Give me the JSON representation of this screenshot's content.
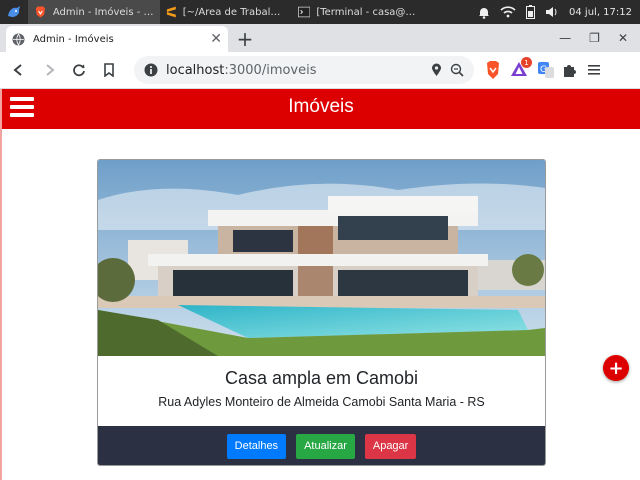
{
  "taskbar": {
    "tasks": [
      {
        "label": "Admin - Imóveis - Br..."
      },
      {
        "label": "[~/Área de Trabalho/i..."
      },
      {
        "label": "[Terminal - casa@cas..."
      }
    ],
    "clock": "04 jul, 17:12"
  },
  "browser": {
    "tab_title": "Admin - Imóveis",
    "url_host": "localhost",
    "url_path": ":3000/imoveis",
    "extension_badge": "1"
  },
  "app": {
    "title": "Imóveis",
    "accent": "#dd0000"
  },
  "card": {
    "title": "Casa ampla em Camobi",
    "address": "Rua Adyles Monteiro de Almeida Camobi Santa Maria - RS",
    "buttons": {
      "details": "Detalhes",
      "update": "Atualizar",
      "delete": "Apagar"
    }
  },
  "fab": {
    "label": "+"
  },
  "icons": [
    "brave-icon",
    "sublime-icon",
    "terminal-icon",
    "bell-icon",
    "wifi-icon",
    "battery-icon",
    "volume-icon",
    "globe-icon",
    "back-icon",
    "forward-icon",
    "reload-icon",
    "bookmark-icon",
    "info-icon",
    "location-icon",
    "zoom-icon",
    "brave-shield-icon",
    "brave-rewards-icon",
    "translate-icon",
    "extensions-icon",
    "menu-icon"
  ]
}
